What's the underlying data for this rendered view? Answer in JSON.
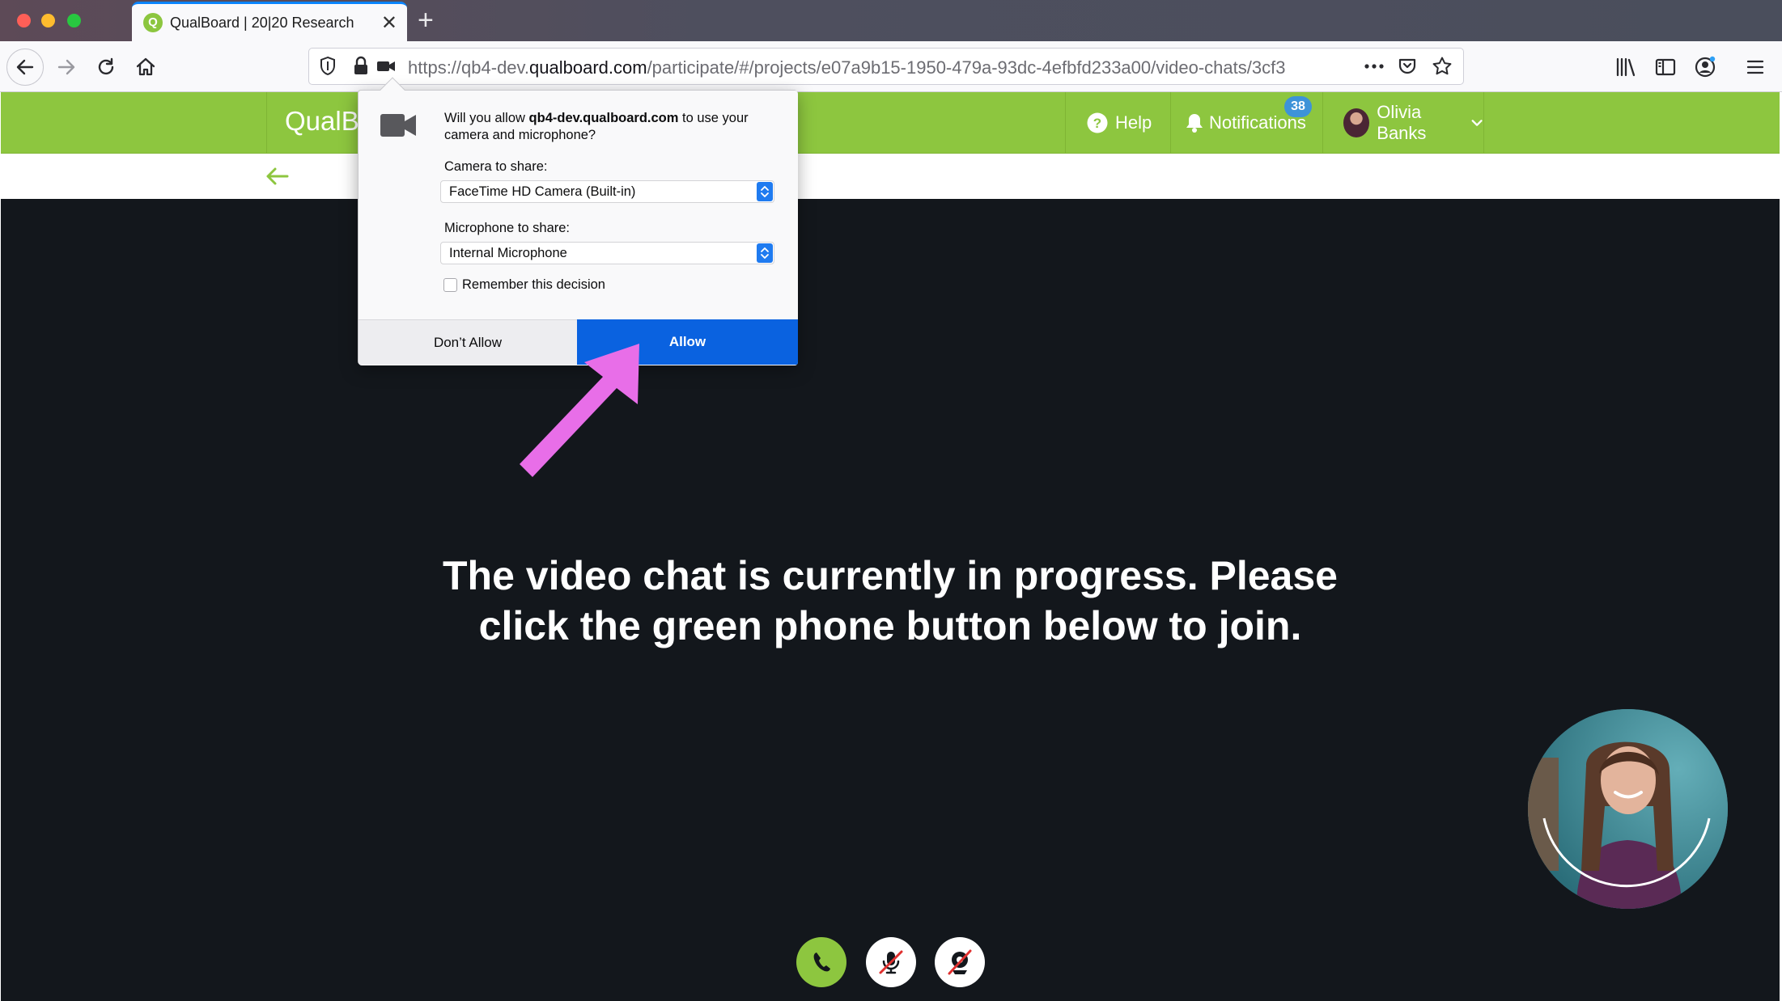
{
  "browser": {
    "tab_title": "QualBoard | 20|20 Research",
    "tab_favicon_letter": "Q",
    "new_tab_label": "+",
    "tab_close_label": "✕",
    "url_prefix": "https://qb4-dev.",
    "url_domain": "qualboard.com",
    "url_path": "/participate/#/projects/e07a9b15-1950-479a-93dc-4efbfd233a00/video-chats/3cf3",
    "icons": [
      "back-icon",
      "forward-icon",
      "reload-icon",
      "home-icon",
      "shield-icon",
      "lock-icon",
      "camera-permission-icon",
      "more-icon",
      "pocket-icon",
      "bookmark-star-icon",
      "library-icon",
      "sidebar-icon",
      "account-icon",
      "menu-icon"
    ],
    "accent_color": "#0a84ff"
  },
  "site": {
    "logo_text": "QualB",
    "help_label": "Help",
    "notifications_label": "Notifications",
    "notifications_count": "38",
    "user_name": "Olivia Banks",
    "brand_color": "#8dc63f"
  },
  "stage": {
    "message_line1": "The video chat is currently in progress. Please",
    "message_line2": "click the green phone button below to join.",
    "controls": [
      "phone-icon",
      "mic-muted-icon",
      "camera-off-icon"
    ]
  },
  "permission_popup": {
    "question_prefix": "Will you allow ",
    "question_domain": "qb4-dev.qualboard.com",
    "question_suffix": " to use your camera and microphone?",
    "camera_label": "Camera to share:",
    "camera_value": "FaceTime HD Camera (Built-in)",
    "microphone_label": "Microphone to share:",
    "microphone_value": "Internal Microphone",
    "remember_label": "Remember this decision",
    "remember_checked": false,
    "deny_label": "Don’t Allow",
    "allow_label": "Allow",
    "allow_color": "#0a62e0"
  },
  "annotation": {
    "arrow_color": "#e86ee8"
  }
}
